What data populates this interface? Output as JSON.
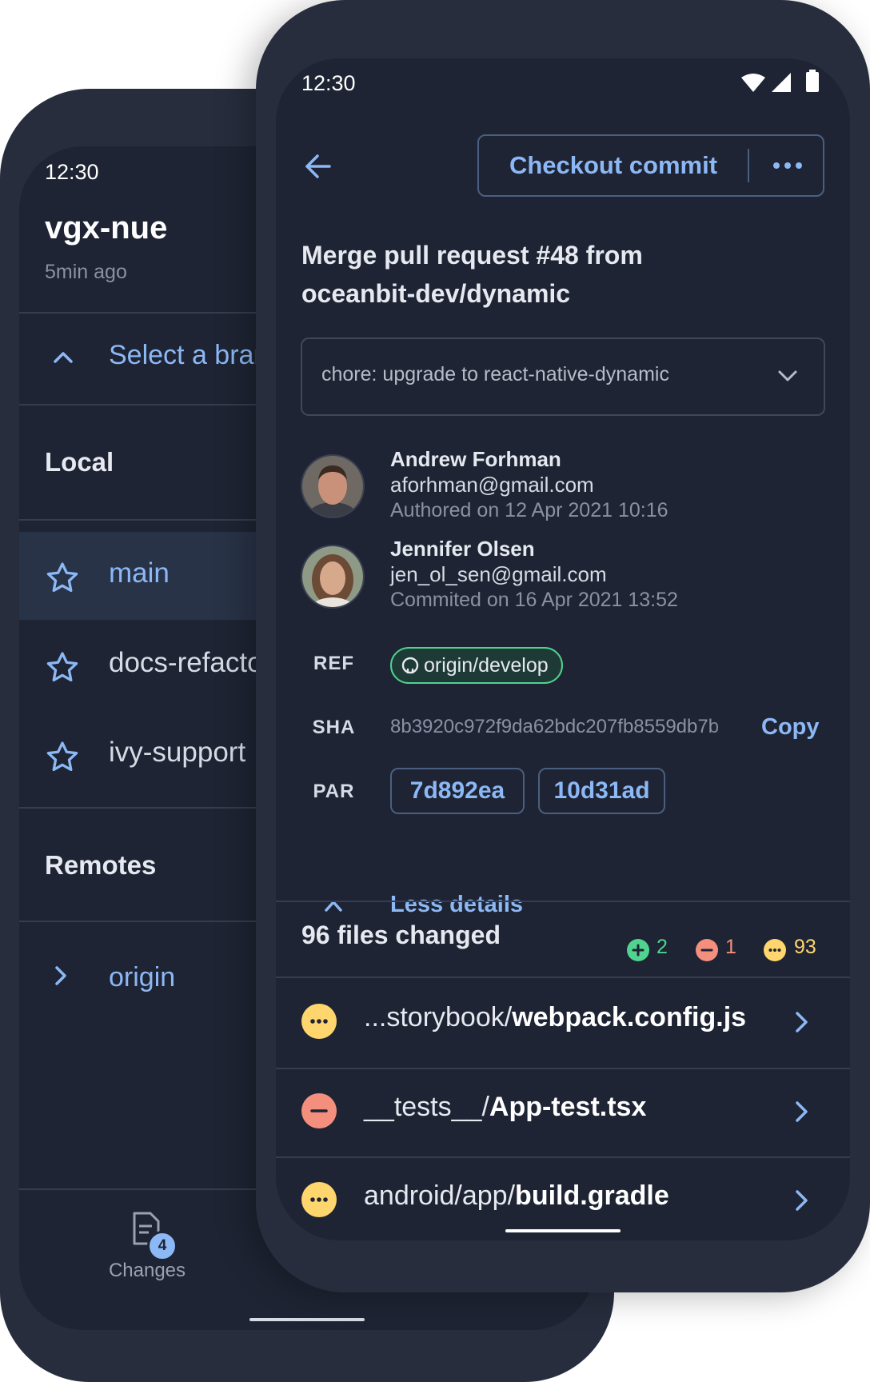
{
  "back_phone": {
    "status_time": "12:30",
    "repo_name": "vgx-nue",
    "repo_updated": "5min ago",
    "branch_selector_label": "Select a branch",
    "local_heading": "Local",
    "branches": [
      {
        "name": "main",
        "active": true
      },
      {
        "name": "docs-refactor",
        "active": false
      },
      {
        "name": "ivy-support",
        "active": false
      }
    ],
    "remotes_heading": "Remotes",
    "remotes": [
      {
        "name": "origin"
      }
    ],
    "bottom_nav": {
      "label": "Changes",
      "badge_count": "4"
    }
  },
  "front_phone": {
    "status_time": "12:30",
    "checkout_label": "Checkout commit",
    "commit_title": "Merge pull request #48 from oceanbit-dev/dynamic",
    "commit_message_preview": "chore: upgrade to react-native-dynamic",
    "author": {
      "name": "Andrew Forhman",
      "email": "aforhman@gmail.com",
      "date_line": "Authored on 12 Apr 2021 10:16"
    },
    "committer": {
      "name": "Jennifer Olsen",
      "email": "jen_ol_sen@gmail.com",
      "date_line": "Commited on 16 Apr 2021 13:52"
    },
    "ref_label": "REF",
    "ref_value": "origin/develop",
    "sha_label": "SHA",
    "sha_value": "8b3920c972f9da62bdc207fb8559db7b",
    "copy_label": "Copy",
    "par_label": "PAR",
    "parents": [
      "7d892ea",
      "10d31ad"
    ],
    "less_details_label": "Less details",
    "files_changed_label": "96 files changed",
    "counts": {
      "added": "2",
      "removed": "1",
      "modified": "93"
    },
    "files": [
      {
        "status": "modified",
        "dir": "...storybook/",
        "file": "webpack.config.js"
      },
      {
        "status": "removed",
        "dir": "__tests__/",
        "file": "App-test.tsx"
      },
      {
        "status": "modified",
        "dir": "android/app/",
        "file": "build.gradle"
      }
    ]
  },
  "colors": {
    "background": "#1e2433",
    "accent": "#8cb8f5",
    "added": "#4fd38e",
    "removed": "#f48f7e",
    "modified": "#fed66d"
  }
}
